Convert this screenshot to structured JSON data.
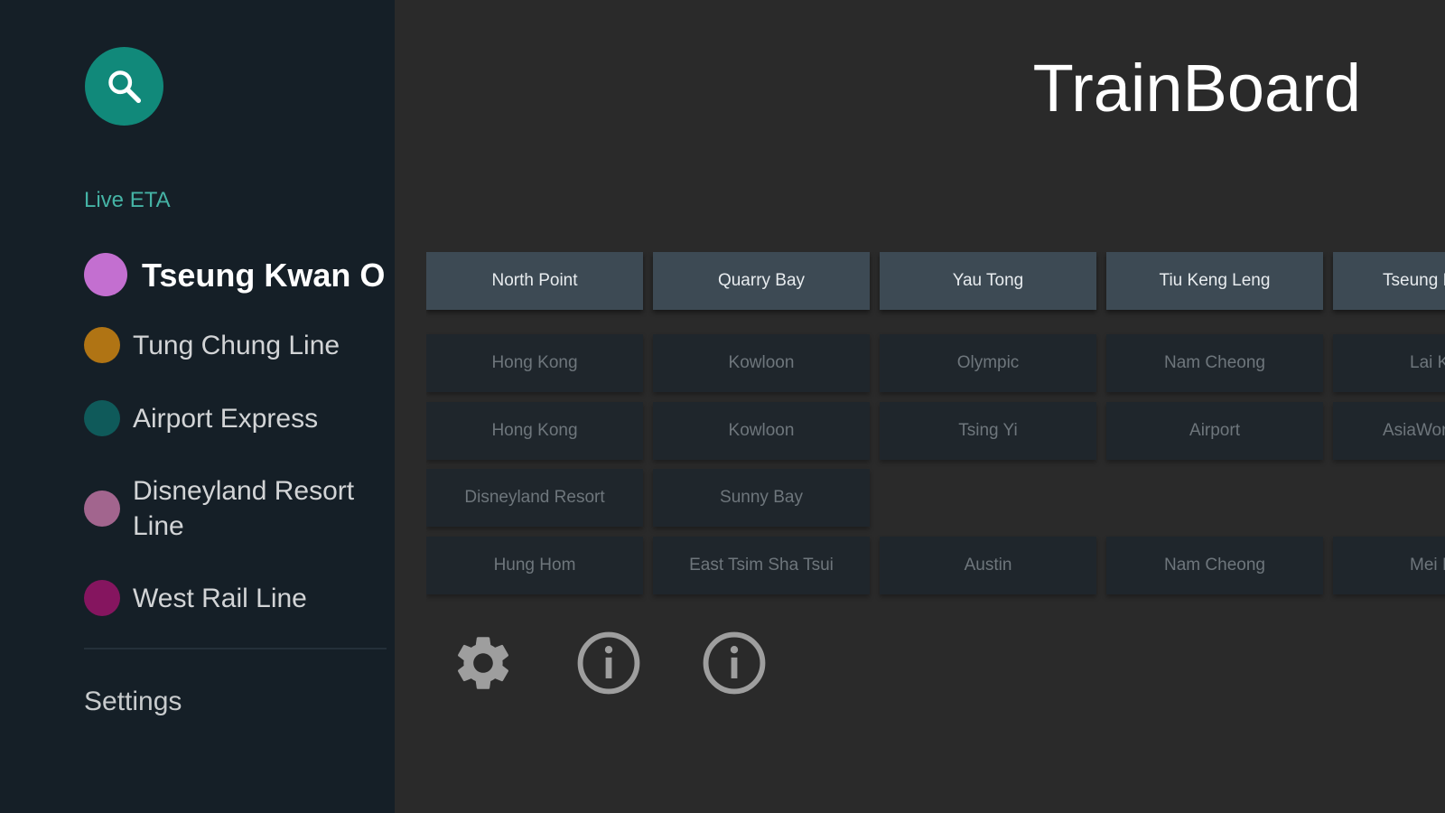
{
  "app": {
    "title": "TrainBoard"
  },
  "sidebar": {
    "search_icon": "search-icon",
    "section_label": "Live ETA",
    "lines": [
      {
        "label": "Tseung Kwan O Li",
        "color": "#c36fd0",
        "selected": true
      },
      {
        "label": "Tung Chung Line",
        "color": "#b07414",
        "selected": false
      },
      {
        "label": "Airport Express",
        "color": "#0f5a5a",
        "selected": false
      },
      {
        "label": "Disneyland Resort Line",
        "color": "#a2658e",
        "selected": false
      },
      {
        "label": "West Rail Line",
        "color": "#85155f",
        "selected": false
      }
    ],
    "settings_label": "Settings"
  },
  "main": {
    "station_columns": [
      {
        "header": "North Point",
        "destinations": [
          "Hong Kong",
          "Hong Kong",
          "Disneyland Resort",
          "Hung Hom"
        ]
      },
      {
        "header": "Quarry Bay",
        "destinations": [
          "Kowloon",
          "Kowloon",
          "Sunny Bay",
          "East Tsim Sha Tsui"
        ]
      },
      {
        "header": "Yau Tong",
        "destinations": [
          "Olympic",
          "Tsing Yi",
          "",
          "Austin"
        ]
      },
      {
        "header": "Tiu Keng Leng",
        "destinations": [
          "Nam Cheong",
          "Airport",
          "",
          "Nam Cheong"
        ]
      },
      {
        "header": "Tseung I",
        "destinations": [
          "Lai K",
          "AsiaWor",
          "",
          "Mei I"
        ]
      }
    ],
    "actions": [
      {
        "icon": "gear-icon"
      },
      {
        "icon": "info-icon"
      },
      {
        "icon": "info-icon"
      }
    ]
  },
  "colors": {
    "sidebar_bg": "#151f27",
    "main_bg": "#2a2a2a",
    "accent": "#11897a",
    "section_label": "#45b3a5",
    "header_cell": "#3d4a54",
    "dest_cell": "#1f262c"
  }
}
